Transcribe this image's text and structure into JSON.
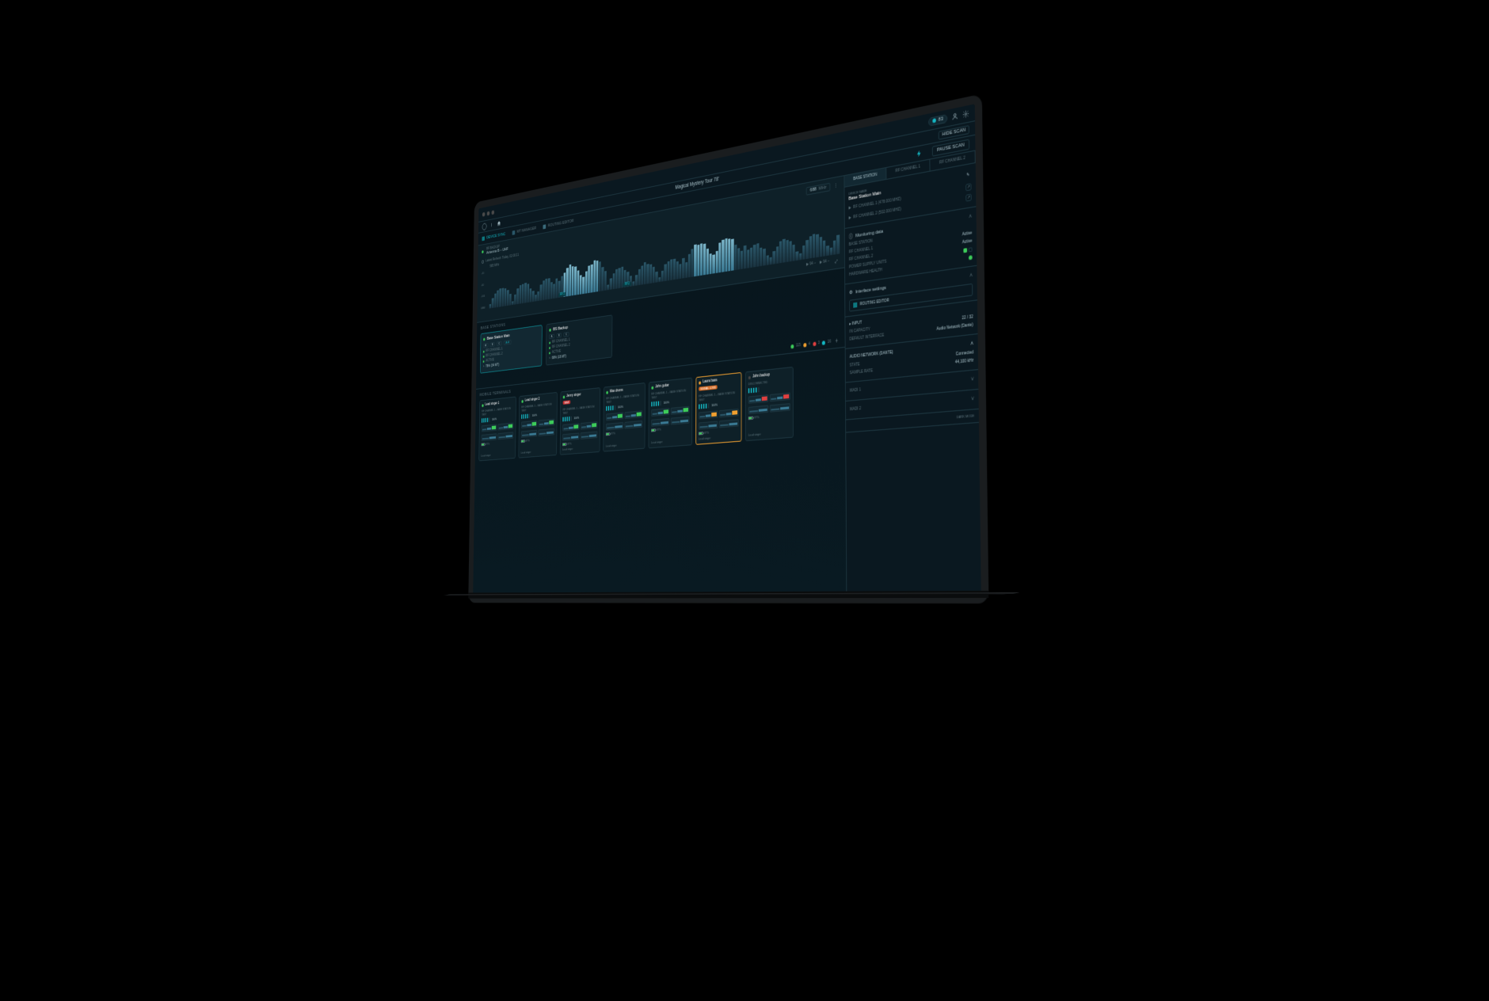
{
  "topbar": {
    "title": "Magical Mystery Tour 78'",
    "badge_num": "83",
    "hide_scan": "HIDE SCAN"
  },
  "toolbar": {
    "device_sync": "DEVICE SYNC",
    "mt_manager": "MT MANAGER",
    "routing_editor": "ROUTING EDITOR",
    "pause_scan": "PAUSE SCAN"
  },
  "rf": {
    "backup_label": "RF BACKUP",
    "antenna": "Antenna B – UHF",
    "freq_value": "688",
    "freq_unit": "MHz",
    "refresh": "Latest Refresh: Today, 02:00:21",
    "axis": [
      "-20",
      "-60",
      "-100",
      "DBM"
    ],
    "freq_lo": "585  MHz",
    "mark1": "RF1",
    "mark2": "RF2",
    "footer_a": "94 –",
    "footer_b": "94 –"
  },
  "base_stations": {
    "title": "BASE STATIONS",
    "cards": [
      {
        "name": "Base Station Main",
        "ch1": "RF CHANNEL 1",
        "ch2": "RF CHANNEL 2",
        "status": "ACTIVE",
        "pct": "76% (34 MT)"
      },
      {
        "name": "BS Backup",
        "ch1": "RF CHANNEL 1",
        "ch2": "RF CHANNEL 2",
        "status": "ACTIVE",
        "pct": "68% (16 MT)"
      }
    ],
    "ant_a": "A",
    "ant_b": "B",
    "ant_c": "C",
    "ant_ab": "A+B"
  },
  "counts": {
    "green": "115",
    "orange": "4",
    "red": "3",
    "cyan": "16"
  },
  "mobile": {
    "title": "MOBILE TERMINALS",
    "items": [
      {
        "name": "Lead singer 1",
        "dot": "g",
        "tag": "",
        "ch": "RF CHANNEL 1 – BASE STATION TEST",
        "lvl": "100%",
        "bat": "87%",
        "foot": "Lead singer"
      },
      {
        "name": "Lead singer 2",
        "dot": "g",
        "tag": "",
        "ch": "RF CHANNEL 1 – BASE STATION TEST",
        "lvl": "100%",
        "bat": "87%",
        "foot": "Lead singer"
      },
      {
        "name": "Jenny singer",
        "dot": "g",
        "tag": "red",
        "tag_label": "NEW",
        "ch": "RF CHANNEL 1 – BASE STATION TEST",
        "lvl": "100%",
        "bat": "87%",
        "foot": "Lead singer"
      },
      {
        "name": "Max drums",
        "dot": "g",
        "tag": "",
        "ch": "RF CHANNEL 1 – BASE STATION TEST",
        "lvl": "100%",
        "bat": "87%",
        "foot": "Lead singer"
      },
      {
        "name": "John guitar",
        "dot": "g",
        "tag": "",
        "ch": "RF CHANNEL 1 – BASE STATION TEST",
        "lvl": "100%",
        "bat": "87%",
        "foot": "Lead singer"
      },
      {
        "name": "Laura bass",
        "dot": "o",
        "tag": "orange",
        "tag_label": "SIGNAL LOSS",
        "ch": "RF CHANNEL 1 – BASE STATION TEST",
        "lvl": "100%",
        "bat": "87%",
        "foot": "Lead singer"
      },
      {
        "name": "John backup",
        "dot": "",
        "tag": "",
        "ch": "DISCONNECTED",
        "lvl": "",
        "bat": "87%",
        "foot": "Lead singer"
      }
    ]
  },
  "sidebar": {
    "tabs": [
      "BASE STATION",
      "RF CHANNEL 1",
      "RF CHANNEL 2"
    ],
    "device_name_label": "Device Name",
    "device_name": "Base Station Main",
    "ch1": "RF CHANNEL 1 (478.000 MHZ)",
    "ch2": "RF CHANNEL 2 (502.000 MHZ)",
    "monitoring_h": "Monitoring data",
    "mon": [
      {
        "k": "BASE STATION",
        "v": ""
      },
      {
        "k": "RF CHANNEL 1",
        "v": "Active"
      },
      {
        "k": "RF CHANNEL 2",
        "v": "Active"
      },
      {
        "k": "POWER SUPPLY UNITS",
        "v": ""
      },
      {
        "k": "HARDWARE HEALTH",
        "v": ""
      }
    ],
    "interface_h": "Interface settings",
    "routing_btn": "ROUTING EDITOR",
    "input_h": "INPUT",
    "capacity_k": "IN CAPACITY",
    "capacity_v": "22 / 32",
    "def_if_k": "DEFAULT INTERFACE",
    "def_if_v": "Audio Network (Dante)",
    "dante_h": "AUDIO NETWORK (DANTE)",
    "state_k": "STATE",
    "state_v": "Connected",
    "sr_k": "SAMPLE RATE",
    "sr_v": "44,100 kHz",
    "madi1": "MADI 1",
    "madi2": "MADI 2",
    "dark": "DARK MODE"
  }
}
